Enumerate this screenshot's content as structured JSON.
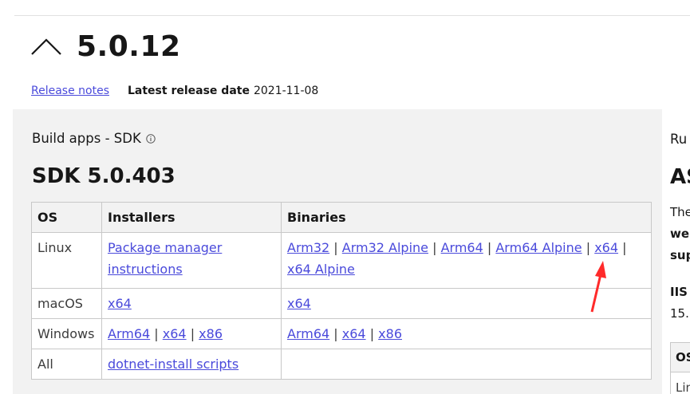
{
  "version": {
    "title": "5.0.12"
  },
  "release": {
    "notes_link": "Release notes",
    "latest_label": "Latest release date",
    "latest_date": "2021-11-08"
  },
  "sdk": {
    "section_label": "Build apps - SDK",
    "title": "SDK 5.0.403",
    "table": {
      "headers": [
        "OS",
        "Installers",
        "Binaries"
      ],
      "rows": {
        "linux": {
          "os": "Linux",
          "installers": [
            "Package manager",
            "instructions"
          ],
          "binaries": [
            "Arm32",
            "Arm32 Alpine",
            "Arm64",
            "Arm64 Alpine",
            "x64",
            "x64 Alpine"
          ]
        },
        "macos": {
          "os": "macOS",
          "installers": [
            "x64"
          ],
          "binaries": [
            "x64"
          ]
        },
        "windows": {
          "os": "Windows",
          "installers": [
            "Arm64",
            "x64",
            "x86"
          ],
          "binaries": [
            "Arm64",
            "x64",
            "x86"
          ]
        },
        "all": {
          "os": "All",
          "installers": [
            "dotnet-install scripts"
          ],
          "binaries": []
        }
      },
      "separator": "|"
    }
  },
  "runtime_panel": {
    "heading_clip": "Ru",
    "title_clip": "AS",
    "line1": "The",
    "line2": "we",
    "line3": "sup",
    "line4": "IIS",
    "line5": "15.",
    "table_header": "OS",
    "table_row": "Lin"
  },
  "colors": {
    "link": "#4a4adb",
    "panel_bg": "#f2f2f2",
    "arrow": "#ff2a2a"
  },
  "icons": {
    "collapse": "chevron-up-icon",
    "info": "info-icon",
    "annotation": "red-arrow-icon"
  }
}
